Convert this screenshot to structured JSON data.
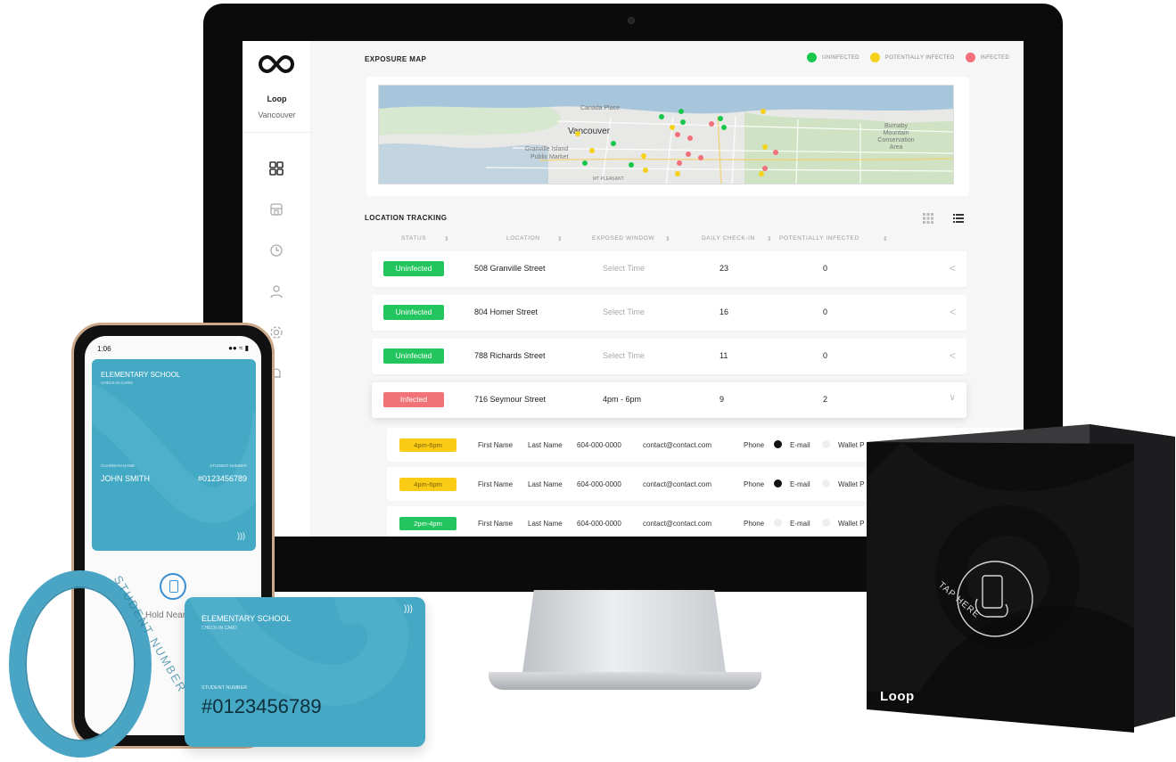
{
  "app": {
    "brand": "Loop",
    "city": "Vancouver"
  },
  "sidebar": {
    "items": [
      {
        "icon": "dashboard-icon"
      },
      {
        "icon": "store-icon"
      },
      {
        "icon": "clock-icon"
      },
      {
        "icon": "user-icon"
      },
      {
        "icon": "gear-icon"
      },
      {
        "icon": "bell-icon"
      }
    ]
  },
  "exposure": {
    "title": "EXPOSURE MAP",
    "legend": [
      {
        "label": "UNINFECTED",
        "color": "#18c64b"
      },
      {
        "label": "POTENTIALLY INFECTED",
        "color": "#f5d11c"
      },
      {
        "label": "INFECTED",
        "color": "#f3707a"
      }
    ],
    "map_labels": {
      "city": "Vancouver",
      "canada_place": "Canada Place",
      "granville": "Granville Island",
      "public_market": "Public Market",
      "burnaby": "Burnaby Mountain Conservation Area",
      "mt_pleasant": "MT PLEASANT"
    }
  },
  "tracking": {
    "title": "LOCATION TRACKING",
    "headers": [
      "STATUS",
      "LOCATION",
      "EXPOSED WINDOW",
      "DAILY CHECK-IN",
      "POTENTIALLY INFECTED"
    ],
    "rows": [
      {
        "status": "Uninfected",
        "status_color": "#22c55e",
        "location": "508 Granville Street",
        "window": "Select Time",
        "checkins": "23",
        "potential": "0",
        "chevron": "<"
      },
      {
        "status": "Uninfected",
        "status_color": "#22c55e",
        "location": "804 Homer Street",
        "window": "Select Time",
        "checkins": "16",
        "potential": "0",
        "chevron": "<"
      },
      {
        "status": "Uninfected",
        "status_color": "#22c55e",
        "location": "788 Richards Street",
        "window": "Select Time",
        "checkins": "11",
        "potential": "0",
        "chevron": "<"
      },
      {
        "status": "Infected",
        "status_color": "#f07477",
        "location": "716 Seymour Street",
        "window": "4pm - 6pm",
        "checkins": "9",
        "potential": "2",
        "chevron": "∨"
      }
    ],
    "sub_rows": [
      {
        "time": "4pm-6pm",
        "time_color": "#facc15",
        "first": "First Name",
        "last": "Last Name",
        "phone": "604-000-0000",
        "email": "contact@contact.com",
        "opt_phone": "Phone",
        "opt_email": "E-mail",
        "opt_wallet": "Wallet P"
      },
      {
        "time": "4pm-6pm",
        "time_color": "#facc15",
        "first": "First Name",
        "last": "Last Name",
        "phone": "604-000-0000",
        "email": "contact@contact.com",
        "opt_phone": "Phone",
        "opt_email": "E-mail",
        "opt_wallet": "Wallet P"
      },
      {
        "time": "2pm-4pm",
        "time_color": "#22c55e",
        "first": "First Name",
        "last": "Last Name",
        "phone": "604-000-0000",
        "email": "contact@contact.com",
        "opt_phone": "Phone",
        "opt_email": "E-mail",
        "opt_wallet": "Wallet P"
      }
    ]
  },
  "phone": {
    "time": "1:06",
    "card_title": "ELEMENTARY SCHOOL",
    "card_subtitle": "CHECK-IN CARD",
    "guardian_label": "GUARDIAN NAME",
    "guardian_name": "JOHN SMITH",
    "student_label": "STUDENT NUMBER",
    "student_number": "#0123456789",
    "hold_text": "Hold Near R"
  },
  "card": {
    "title": "ELEMENTARY SCHOOL",
    "subtitle": "CHECK-IN CARD",
    "student_label": "STUDENT NUMBER",
    "student_number": "#0123456789"
  },
  "wristband": {
    "text": "STUDENT NUMBER"
  },
  "box": {
    "tap_text": "TAP HERE",
    "logo": "Loop"
  }
}
